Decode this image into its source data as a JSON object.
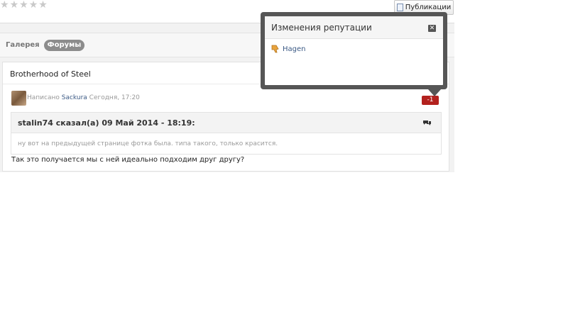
{
  "header": {
    "rating_stars": 5,
    "publications_button": "Публикации",
    "publications_icon": "document-icon"
  },
  "tabs": [
    {
      "label": "Галерея",
      "active": false
    },
    {
      "label": "Форумы",
      "active": true
    }
  ],
  "topic": {
    "title": "Brotherhood of Steel"
  },
  "post": {
    "written_by_label": "Написано",
    "author": "Sackura",
    "time": "Сегодня, 17:20",
    "reputation": "-1",
    "reputation_color": "#b3211e",
    "quote": {
      "citation": "stalin74 сказал(а) 09 Май 2014 - 18:19:",
      "text": "ну вот на предыдущей странице фотка была. типа такого, только красится."
    },
    "body": "Так это получается мы с ней идеально подходим друг другу?"
  },
  "reputation_popup": {
    "title": "Изменения репутации",
    "close_icon": "close-icon",
    "entries": [
      {
        "icon": "thumbs-down-icon",
        "user": "Hagen"
      }
    ]
  }
}
